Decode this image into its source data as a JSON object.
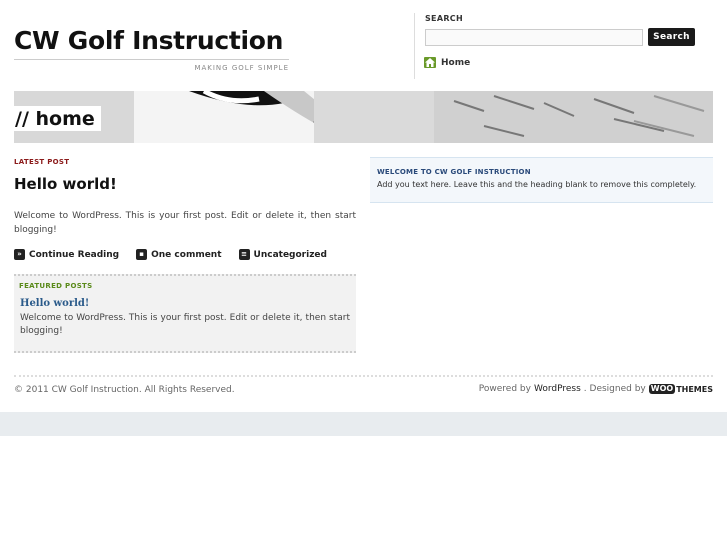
{
  "header": {
    "site_title": "CW Golf Instruction",
    "tagline": "MAKING GOLF SIMPLE"
  },
  "search": {
    "label": "SEARCH",
    "value": "",
    "button_label": "Search"
  },
  "nav": {
    "home_label": "Home",
    "home_icon": "home-icon"
  },
  "banner": {
    "label": "// home"
  },
  "latest_post": {
    "section_label": "LATEST POST",
    "title": "Hello world!",
    "excerpt": "Welcome to WordPress. This is your first post. Edit or delete it, then start blogging!",
    "meta": {
      "continue_label": "Continue Reading",
      "comments_label": "One comment",
      "category_label": "Uncategorized"
    }
  },
  "featured": {
    "section_label": "FEATURED POSTS",
    "title": "Hello world!",
    "excerpt": "Welcome to WordPress. This is your first post. Edit or delete it, then start blogging!"
  },
  "widget": {
    "title": "WELCOME TO CW GOLF INSTRUCTION",
    "text": "Add you text here. Leave this and the heading blank to remove this completely."
  },
  "footer": {
    "copyright": "© 2011 CW Golf Instruction. All Rights Reserved.",
    "powered_prefix": "Powered by",
    "powered_link": "WordPress",
    "designed_prefix": ". Designed by",
    "woo_part1": "WOO",
    "woo_part2": "THEMES"
  },
  "colors": {
    "latest_label": "#8b1a1a",
    "featured_label": "#5a8a1a",
    "featured_title": "#2a5a8a",
    "widget_title": "#2a4a7a",
    "search_button": "#1a1a1a",
    "home_icon": "#6a9a2a"
  }
}
